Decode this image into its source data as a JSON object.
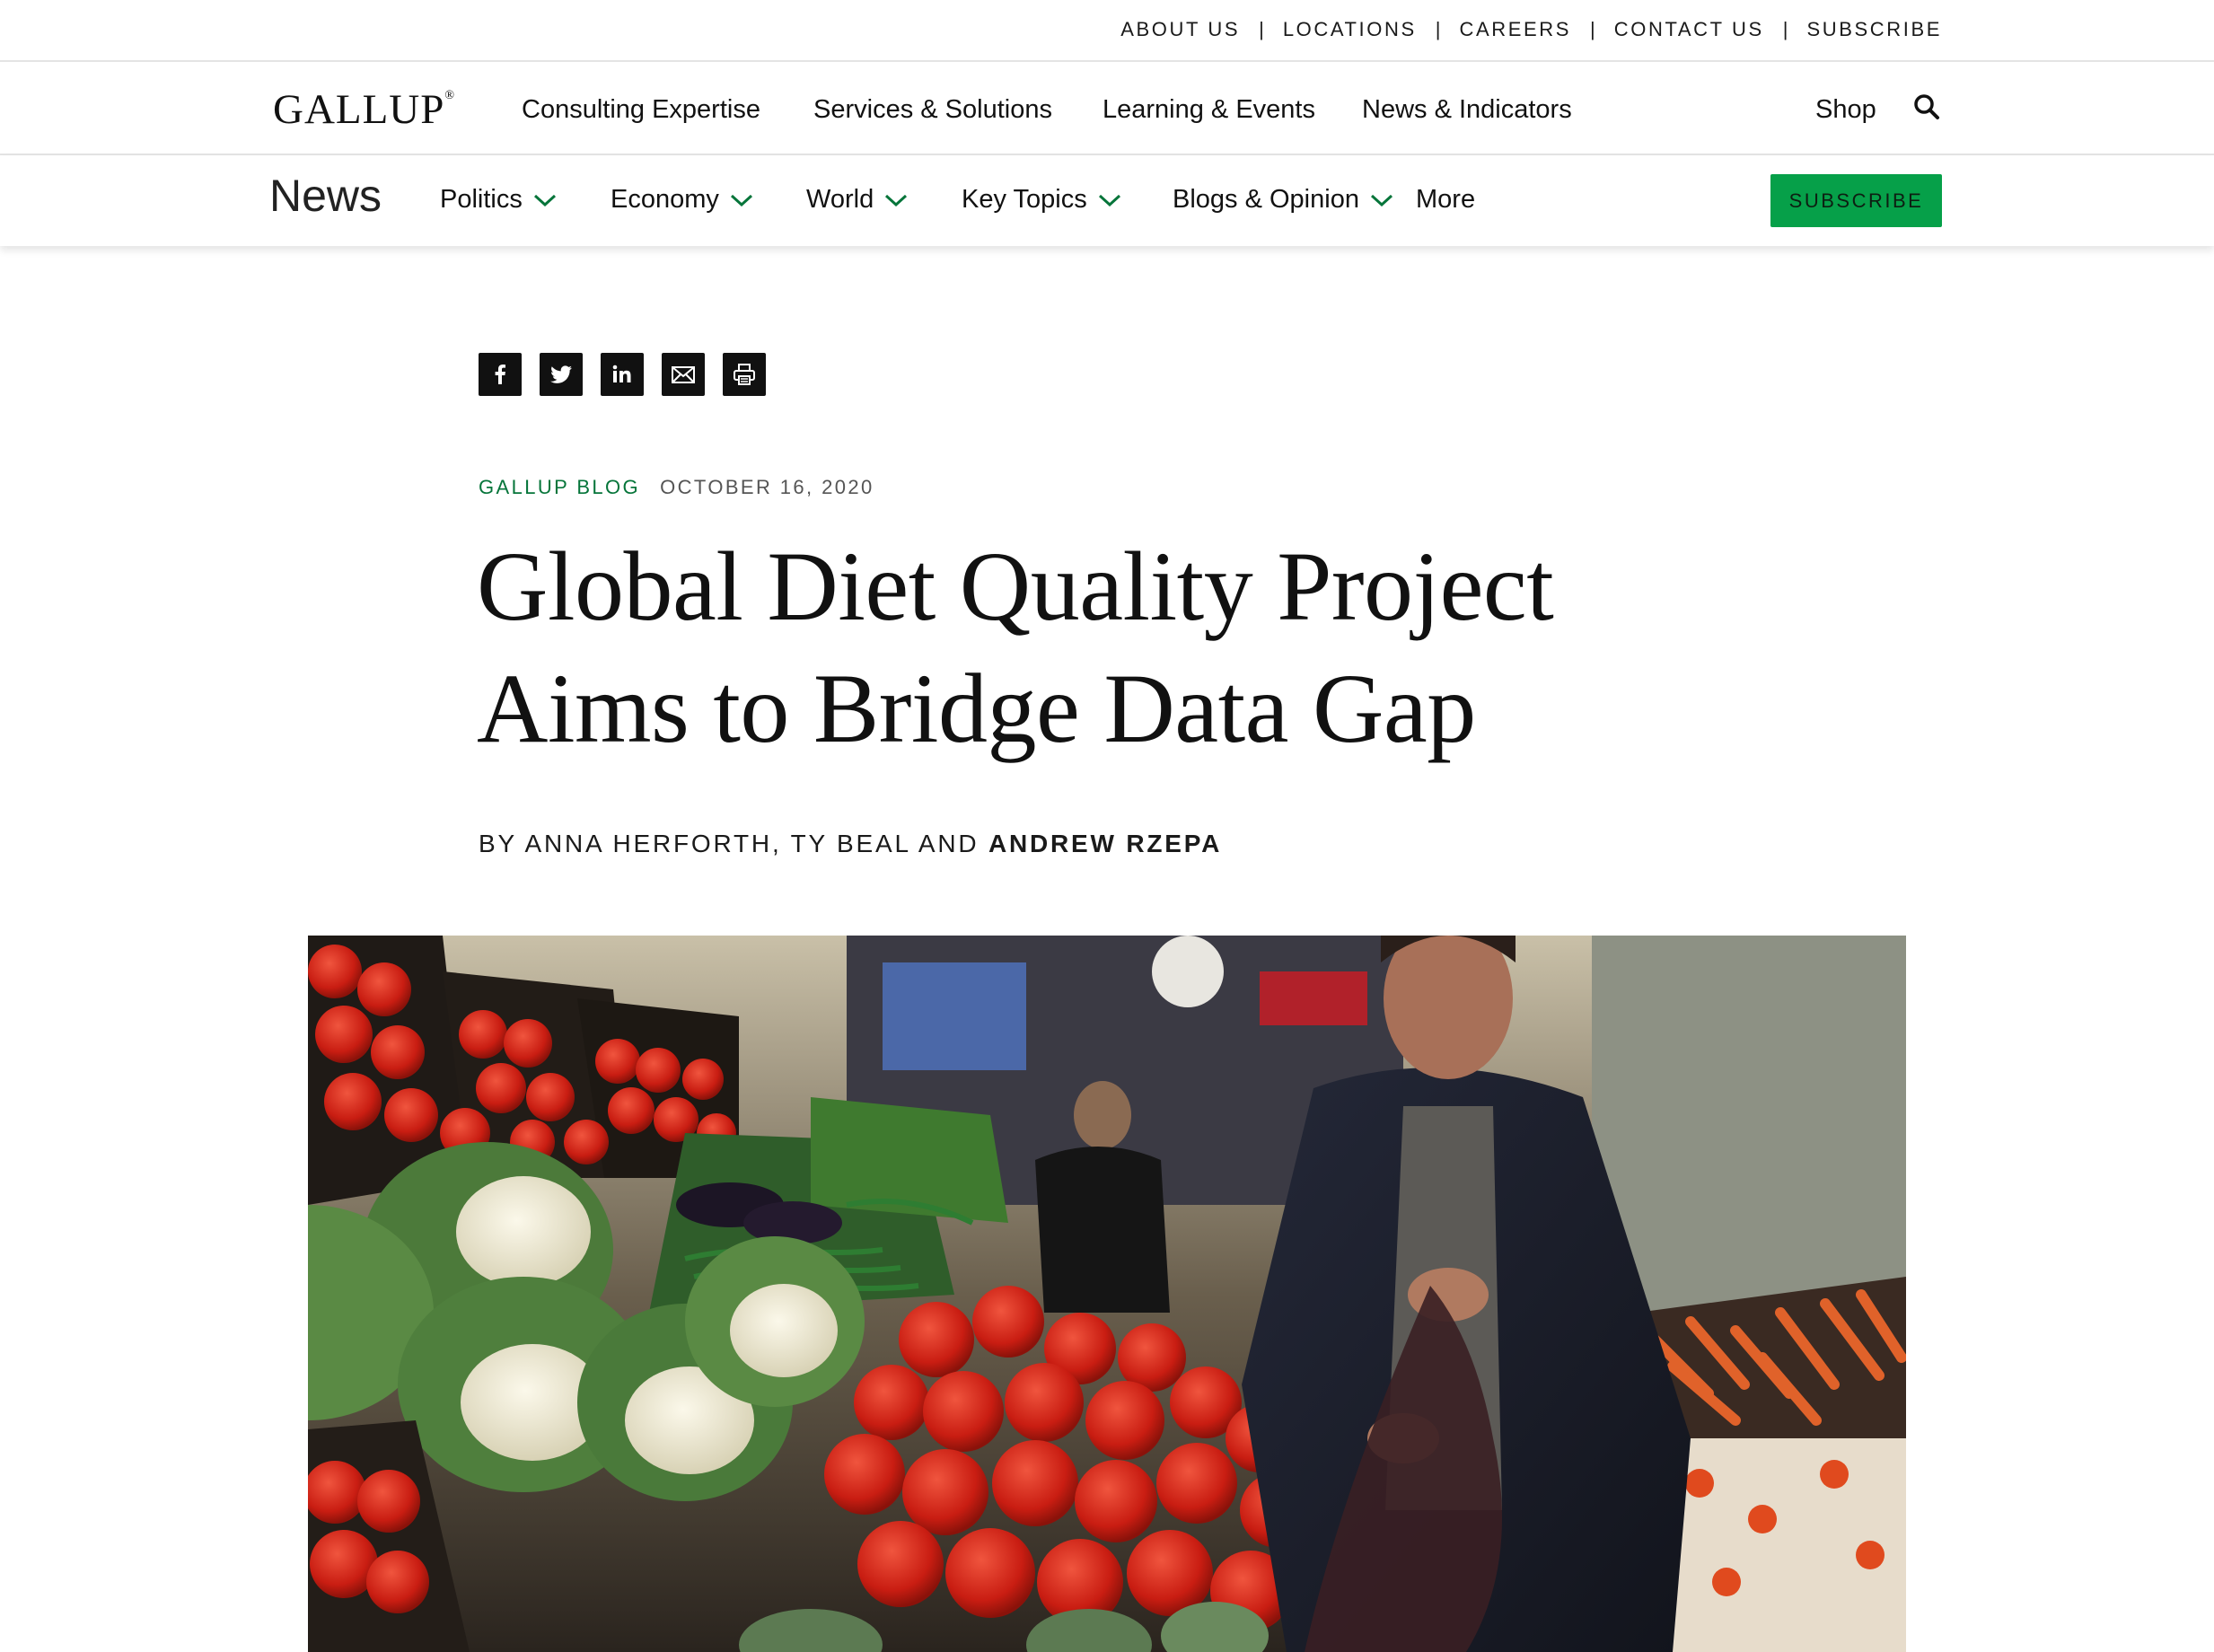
{
  "utility": {
    "links": [
      "ABOUT US",
      "LOCATIONS",
      "CAREERS",
      "CONTACT US",
      "SUBSCRIBE"
    ]
  },
  "mainnav": {
    "logo": "GALLUP",
    "logo_mark": "®",
    "items": [
      "Consulting Expertise",
      "Services & Solutions",
      "Learning & Events",
      "News & Indicators"
    ],
    "shop": "Shop",
    "search_icon": "search-icon"
  },
  "sectionnav": {
    "title": "News",
    "items": [
      "Politics",
      "Economy",
      "World",
      "Key Topics",
      "Blogs & Opinion",
      "More"
    ],
    "subscribe": "SUBSCRIBE"
  },
  "share": {
    "icons": [
      "facebook-icon",
      "twitter-icon",
      "linkedin-icon",
      "email-icon",
      "print-icon"
    ]
  },
  "article": {
    "category": "GALLUP BLOG",
    "date": "OCTOBER 16, 2020",
    "headline_line1": "Global Diet Quality Project",
    "headline_line2": "Aims to Bridge Data Gap",
    "byline_prefix": "BY ANNA HERFORTH, TY BEAL AND ",
    "byline_bold": "ANDREW RZEPA"
  },
  "colors": {
    "accent_green": "#06a049",
    "category_green": "#06753a"
  }
}
